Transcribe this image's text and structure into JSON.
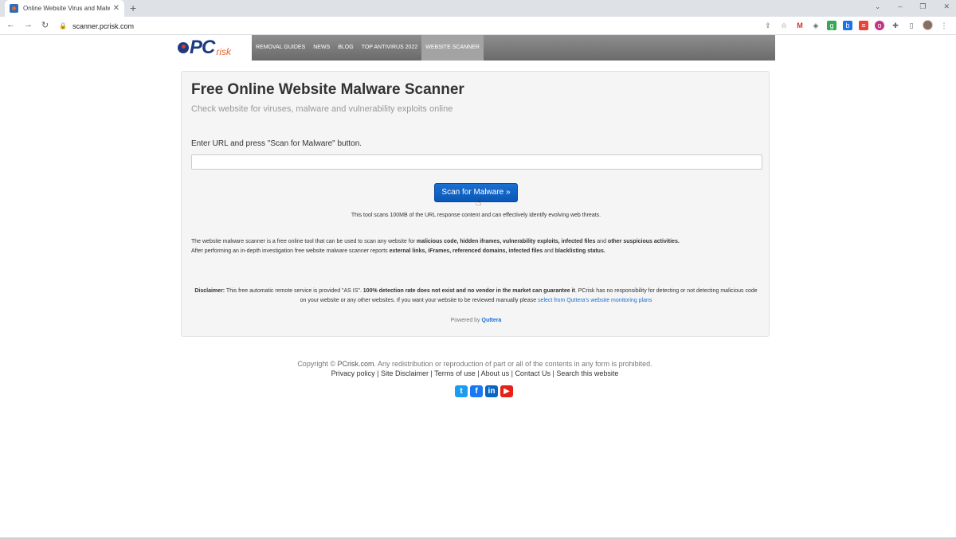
{
  "browser": {
    "tab_title": "Online Website Virus and Malwa",
    "tab_close": "✕",
    "new_tab": "+",
    "url": "scanner.pcrisk.com",
    "back": "←",
    "forward": "→",
    "reload": "↻",
    "lock": "🔒",
    "window_controls": [
      "⌄",
      "–",
      "❐",
      "✕"
    ]
  },
  "site": {
    "logo_pc": "PC",
    "logo_risk": "risk",
    "nav": [
      {
        "label": "REMOVAL GUIDES"
      },
      {
        "label": "NEWS"
      },
      {
        "label": "BLOG"
      },
      {
        "label": "TOP ANTIVIRUS 2022"
      },
      {
        "label": "WEBSITE SCANNER",
        "active": true
      }
    ]
  },
  "scanner": {
    "title": "Free Online Website Malware Scanner",
    "subtitle": "Check website for viruses, malware and vulnerability exploits online",
    "prompt": "Enter URL and press \"Scan for Malware\" button.",
    "url_value": "",
    "button": "Scan for Malware »",
    "note": "This tool scans 100MB of the URL response content and can effectively identify evolving web threats.",
    "desc_1": "The website malware scanner is a free online tool that can be used to scan any website for ",
    "desc_b1": "malicious code, hidden iframes, vulnerability exploits, infected files",
    "desc_2": " and ",
    "desc_b2": "other suspicious activities.",
    "desc_3": "After performing an in-depth investigation free website malware scanner reports ",
    "desc_b3": "external links, iFrames, referenced domains, infected files",
    "desc_4": " and ",
    "desc_b4": "blacklisting status.",
    "disclaimer_label": "Disclaimer:",
    "disclaimer_1": " This free automatic remote service is provided \"AS IS\". ",
    "disclaimer_b": "100% detection rate does not exist and no vendor in the market can guarantee it",
    "disclaimer_2": ". PCrisk has no responsibility for detecting or not detecting malicious code on your website or any other websites. If you want your website to be reviewed manually please ",
    "disclaimer_link": "select from Quttera's website monitoring plans",
    "powered_label": "Powered by ",
    "powered_brand": "Quttera"
  },
  "footer": {
    "copyright_1": "Copyright © ",
    "copyright_site": "PCrisk.com",
    "copyright_2": ". Any redistribution or reproduction of part or all of the contents in any form is prohibited.",
    "links": [
      "Privacy policy",
      "Site Disclaimer",
      "Terms of use",
      "About us",
      "Contact Us",
      "Search this website"
    ],
    "social": {
      "twitter": "t",
      "facebook": "f",
      "linkedin": "in",
      "youtube": "▶"
    }
  }
}
